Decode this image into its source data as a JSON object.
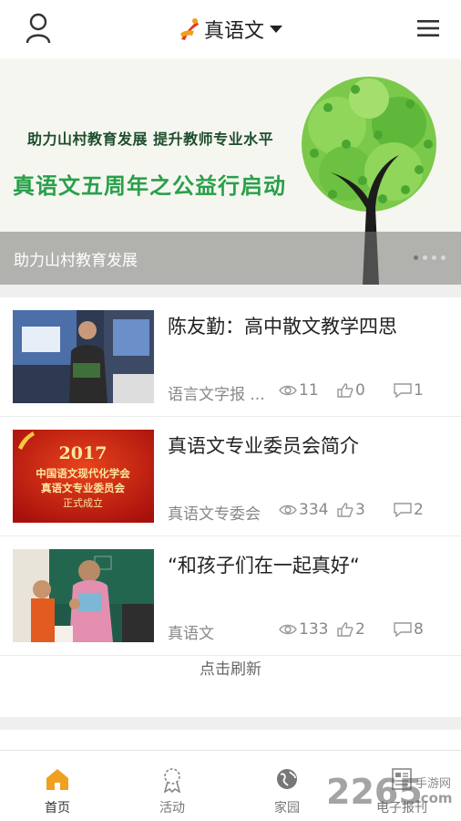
{
  "header": {
    "title": "真语文",
    "user_icon": "user-icon",
    "menu_icon": "hamburger-menu-icon",
    "dropdown_icon": "caret-down-icon"
  },
  "banner": {
    "subtitle": "助力山村教育发展 提升教师专业水平",
    "headline": "真语文五周年之公益行启动",
    "caption": "助力山村教育发展",
    "slide_count": 4,
    "active_slide": 1
  },
  "articles": [
    {
      "title": "陈友勤：高中散文教学四思",
      "source": "语言文字报 ...",
      "views": "11",
      "likes": "0",
      "comments": "1"
    },
    {
      "title": "真语文专业委员会简介",
      "source": "真语文专委会",
      "views": "334",
      "likes": "3",
      "comments": "2",
      "thumb_text": {
        "year": "2017",
        "line1": "中国语文现代化学会",
        "line2": "真语文专业委员会",
        "line3": "正式成立"
      }
    },
    {
      "title": "“和孩子们在一起真好“",
      "source": "真语文",
      "views": "133",
      "likes": "2",
      "comments": "8"
    }
  ],
  "refresh_label": "点击刷新",
  "tabs": [
    {
      "label": "首页",
      "icon": "home-icon",
      "active": true
    },
    {
      "label": "活动",
      "icon": "award-ribbon-icon",
      "active": false
    },
    {
      "label": "家园",
      "icon": "globe-icon",
      "active": false
    },
    {
      "label": "电子报刊",
      "icon": "newspaper-icon",
      "active": false
    }
  ],
  "watermark": {
    "number": "2265",
    "site": "手游网",
    "domain": ".com"
  },
  "colors": {
    "accent": "#f0a020",
    "banner_green": "#28a04a",
    "thumb_red": "#c01810"
  }
}
